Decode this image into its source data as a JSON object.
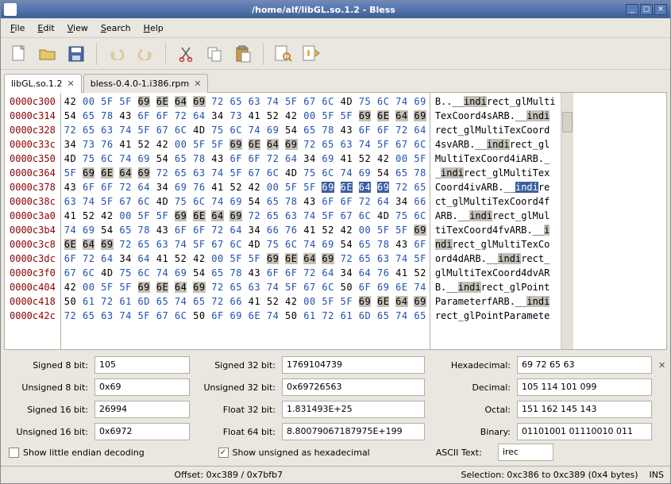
{
  "window": {
    "title": "/home/alf/libGL.so.1.2 - Bless"
  },
  "menu": {
    "file": "File",
    "edit": "Edit",
    "view": "View",
    "search": "Search",
    "help": "Help"
  },
  "tabs": [
    {
      "label": "libGL.so.1.2",
      "active": true
    },
    {
      "label": "bless-0.4.0-1.i386.rpm",
      "active": false
    }
  ],
  "hex_rows": [
    {
      "offset": "0000c300",
      "bytes": [
        "42",
        "00",
        "5F",
        "5F",
        [
          "69",
          "hl"
        ],
        [
          "6E",
          "hl"
        ],
        [
          "64",
          "hl"
        ],
        [
          "69",
          "hl"
        ],
        "72",
        "65",
        "63",
        "74",
        "5F",
        "67",
        "6C",
        "4D",
        "75",
        "6C",
        "74",
        "69"
      ],
      "ascii": [
        [
          "B."
        ],
        [
          ".__"
        ],
        [
          "indi",
          "hl"
        ],
        [
          "rect_glMulti"
        ]
      ]
    },
    {
      "offset": "0000c314",
      "bytes": [
        "54",
        "65",
        "78",
        "43",
        "6F",
        "6F",
        "72",
        "64",
        "34",
        "73",
        "41",
        "52",
        "42",
        "00",
        "5F",
        "5F",
        [
          "69",
          "hl"
        ],
        [
          "6E",
          "hl"
        ],
        [
          "64",
          "hl"
        ],
        [
          "69",
          "hl"
        ]
      ],
      "ascii": [
        [
          "TexCoord4sARB"
        ],
        [
          ".__"
        ],
        [
          "indi",
          "hl"
        ]
      ]
    },
    {
      "offset": "0000c328",
      "bytes": [
        "72",
        "65",
        "63",
        "74",
        "5F",
        "67",
        "6C",
        "4D",
        "75",
        "6C",
        "74",
        "69",
        "54",
        "65",
        "78",
        "43",
        "6F",
        "6F",
        "72",
        "64"
      ],
      "ascii": [
        [
          "rect_glMultiTexCoord"
        ]
      ]
    },
    {
      "offset": "0000c33c",
      "bytes": [
        "34",
        "73",
        "76",
        "41",
        "52",
        "42",
        "00",
        "5F",
        "5F",
        [
          "69",
          "hl"
        ],
        [
          "6E",
          "hl"
        ],
        [
          "64",
          "hl"
        ],
        [
          "69",
          "hl"
        ],
        "72",
        "65",
        "63",
        "74",
        "5F",
        "67",
        "6C"
      ],
      "ascii": [
        [
          "4svARB"
        ],
        [
          ".__"
        ],
        [
          "indi",
          "hl"
        ],
        [
          "rect_gl"
        ]
      ]
    },
    {
      "offset": "0000c350",
      "bytes": [
        "4D",
        "75",
        "6C",
        "74",
        "69",
        "54",
        "65",
        "78",
        "43",
        "6F",
        "6F",
        "72",
        "64",
        "34",
        "69",
        "41",
        "52",
        "42",
        "00",
        "5F"
      ],
      "ascii": [
        [
          "MultiTexCoord4iARB"
        ],
        [
          "._"
        ]
      ]
    },
    {
      "offset": "0000c364",
      "bytes": [
        "5F",
        [
          "69",
          "hl"
        ],
        [
          "6E",
          "hl"
        ],
        [
          "64",
          "hl"
        ],
        [
          "69",
          "hl"
        ],
        "72",
        "65",
        "63",
        "74",
        "5F",
        "67",
        "6C",
        "4D",
        "75",
        "6C",
        "74",
        "69",
        "54",
        "65",
        "78"
      ],
      "ascii": [
        [
          "_"
        ],
        [
          "indi",
          "hl"
        ],
        [
          "rect_glMultiTex"
        ]
      ]
    },
    {
      "offset": "0000c378",
      "bytes": [
        "43",
        "6F",
        "6F",
        "72",
        "64",
        "34",
        "69",
        "76",
        "41",
        "52",
        "42",
        "00",
        "5F",
        "5F",
        [
          "69",
          "sel"
        ],
        [
          "6E",
          "sel"
        ],
        [
          "64",
          "sel"
        ],
        [
          "69",
          "sel"
        ],
        "72",
        "65"
      ],
      "ascii": [
        [
          "Coord4ivARB"
        ],
        [
          ".__"
        ],
        [
          "indi",
          "sel"
        ],
        [
          "re"
        ]
      ]
    },
    {
      "offset": "0000c38c",
      "bytes": [
        "63",
        "74",
        "5F",
        "67",
        "6C",
        "4D",
        "75",
        "6C",
        "74",
        "69",
        "54",
        "65",
        "78",
        "43",
        "6F",
        "6F",
        "72",
        "64",
        "34",
        "66"
      ],
      "ascii": [
        [
          "ct_glMultiTexCoord4f"
        ]
      ]
    },
    {
      "offset": "0000c3a0",
      "bytes": [
        "41",
        "52",
        "42",
        "00",
        "5F",
        "5F",
        [
          "69",
          "hl"
        ],
        [
          "6E",
          "hl"
        ],
        [
          "64",
          "hl"
        ],
        [
          "69",
          "hl"
        ],
        "72",
        "65",
        "63",
        "74",
        "5F",
        "67",
        "6C",
        "4D",
        "75",
        "6C"
      ],
      "ascii": [
        [
          "ARB"
        ],
        [
          ".__"
        ],
        [
          "indi",
          "hl"
        ],
        [
          "rect_glMul"
        ]
      ]
    },
    {
      "offset": "0000c3b4",
      "bytes": [
        "74",
        "69",
        "54",
        "65",
        "78",
        "43",
        "6F",
        "6F",
        "72",
        "64",
        "34",
        "66",
        "76",
        "41",
        "52",
        "42",
        "00",
        "5F",
        "5F",
        [
          "69",
          "hl"
        ]
      ],
      "ascii": [
        [
          "tiTexCoord4fvARB"
        ],
        [
          ".__"
        ],
        [
          "i",
          "hl"
        ]
      ]
    },
    {
      "offset": "0000c3c8",
      "bytes": [
        [
          "6E",
          "hl"
        ],
        [
          "64",
          "hl"
        ],
        [
          "69",
          "hl"
        ],
        "72",
        "65",
        "63",
        "74",
        "5F",
        "67",
        "6C",
        "4D",
        "75",
        "6C",
        "74",
        "69",
        "54",
        "65",
        "78",
        "43",
        "6F"
      ],
      "ascii": [
        [
          "ndi",
          "hl"
        ],
        [
          "rect_glMultiTexCo"
        ]
      ]
    },
    {
      "offset": "0000c3dc",
      "bytes": [
        "6F",
        "72",
        "64",
        "34",
        "64",
        "41",
        "52",
        "42",
        "00",
        "5F",
        "5F",
        [
          "69",
          "hl"
        ],
        [
          "6E",
          "hl"
        ],
        [
          "64",
          "hl"
        ],
        [
          "69",
          "hl"
        ],
        "72",
        "65",
        "63",
        "74",
        "5F"
      ],
      "ascii": [
        [
          "ord4dARB"
        ],
        [
          ".__"
        ],
        [
          "indi",
          "hl"
        ],
        [
          "rect_"
        ]
      ]
    },
    {
      "offset": "0000c3f0",
      "bytes": [
        "67",
        "6C",
        "4D",
        "75",
        "6C",
        "74",
        "69",
        "54",
        "65",
        "78",
        "43",
        "6F",
        "6F",
        "72",
        "64",
        "34",
        "64",
        "76",
        "41",
        "52"
      ],
      "ascii": [
        [
          "glMultiTexCoord4dvAR"
        ]
      ]
    },
    {
      "offset": "0000c404",
      "bytes": [
        "42",
        "00",
        "5F",
        "5F",
        [
          "69",
          "hl"
        ],
        [
          "6E",
          "hl"
        ],
        [
          "64",
          "hl"
        ],
        [
          "69",
          "hl"
        ],
        "72",
        "65",
        "63",
        "74",
        "5F",
        "67",
        "6C",
        "50",
        "6F",
        "69",
        "6E",
        "74"
      ],
      "ascii": [
        [
          "B"
        ],
        [
          ".__"
        ],
        [
          "indi",
          "hl"
        ],
        [
          "rect_glPoint"
        ]
      ]
    },
    {
      "offset": "0000c418",
      "bytes": [
        "50",
        "61",
        "72",
        "61",
        "6D",
        "65",
        "74",
        "65",
        "72",
        "66",
        "41",
        "52",
        "42",
        "00",
        "5F",
        "5F",
        [
          "69",
          "hl"
        ],
        [
          "6E",
          "hl"
        ],
        [
          "64",
          "hl"
        ],
        [
          "69",
          "hl"
        ]
      ],
      "ascii": [
        [
          "ParameterfARB"
        ],
        [
          ".__"
        ],
        [
          "indi",
          "hl"
        ]
      ]
    },
    {
      "offset": "0000c42c",
      "bytes": [
        "72",
        "65",
        "63",
        "74",
        "5F",
        "67",
        "6C",
        "50",
        "6F",
        "69",
        "6E",
        "74",
        "50",
        "61",
        "72",
        "61",
        "6D",
        "65",
        "74",
        "65"
      ],
      "ascii": [
        [
          "rect_glPointParamete"
        ]
      ]
    }
  ],
  "inspector": {
    "s8": {
      "label": "Signed 8 bit:",
      "val": "105"
    },
    "u8": {
      "label": "Unsigned 8 bit:",
      "val": "0x69"
    },
    "s16": {
      "label": "Signed 16 bit:",
      "val": "26994"
    },
    "u16": {
      "label": "Unsigned 16 bit:",
      "val": "0x6972"
    },
    "s32": {
      "label": "Signed 32 bit:",
      "val": "1769104739"
    },
    "u32": {
      "label": "Unsigned 32 bit:",
      "val": "0x69726563"
    },
    "f32": {
      "label": "Float 32 bit:",
      "val": "1.831493E+25"
    },
    "f64": {
      "label": "Float 64 bit:",
      "val": "8.80079067187975E+199"
    },
    "hex": {
      "label": "Hexadecimal:",
      "val": "69 72 65 63"
    },
    "dec": {
      "label": "Decimal:",
      "val": "105 114 101 099"
    },
    "oct": {
      "label": "Octal:",
      "val": "151 162 145 143"
    },
    "bin": {
      "label": "Binary:",
      "val": "01101001 01110010 011"
    },
    "ascii": {
      "label": "ASCII Text:",
      "val": "irec"
    }
  },
  "checks": {
    "little_endian": "Show little endian decoding",
    "unsigned_hex": "Show unsigned as hexadecimal"
  },
  "status": {
    "offset": "Offset: 0xc389 / 0x7bfb7",
    "selection": "Selection: 0xc386 to 0xc389 (0x4 bytes)",
    "ins": "INS"
  }
}
